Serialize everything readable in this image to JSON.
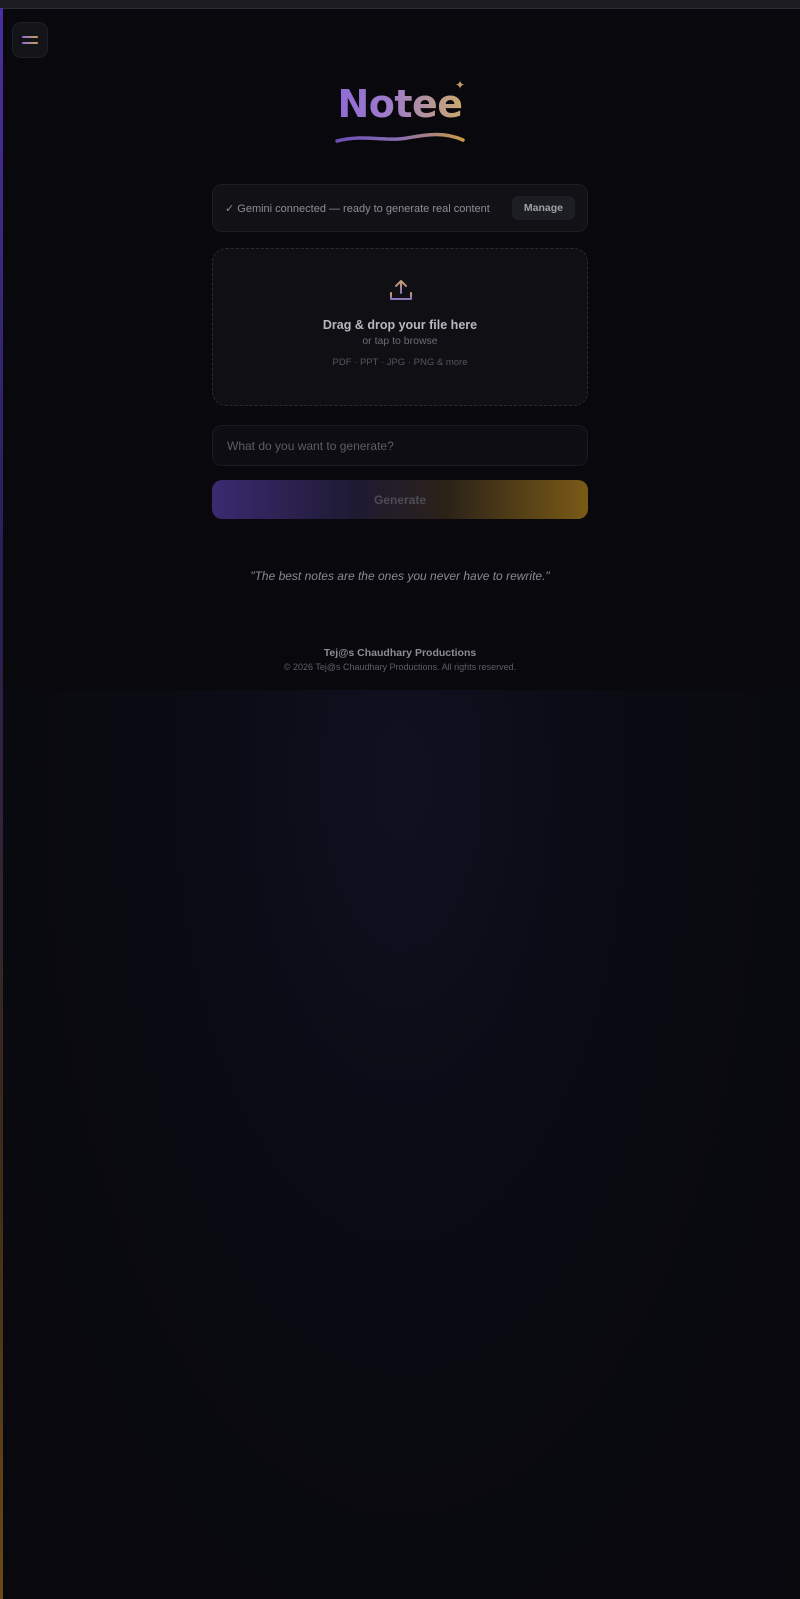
{
  "app": {
    "logo": "Notee",
    "sparkle": "✦"
  },
  "status": {
    "check": "✓",
    "text": "Gemini connected — ready to generate real content",
    "manage_label": "Manage"
  },
  "upload": {
    "title": "Drag & drop your file here",
    "subtitle": "or tap to browse",
    "formats": "PDF · PPT · JPG · PNG & more",
    "icon": "upload-icon"
  },
  "prompt": {
    "placeholder": "What do you want to generate?",
    "value": ""
  },
  "generate": {
    "label": "Generate"
  },
  "quote": "\"The best notes are the ones you never have to rewrite.\"",
  "footer": {
    "brand": "Tej@s Chaudhary Productions",
    "copyright": "© 2026 Tej@s Chaudhary Productions. All rights reserved."
  },
  "colors": {
    "background": "#08080d",
    "accent_purple": "#8f6ad6",
    "accent_gold": "#c9a96e"
  }
}
